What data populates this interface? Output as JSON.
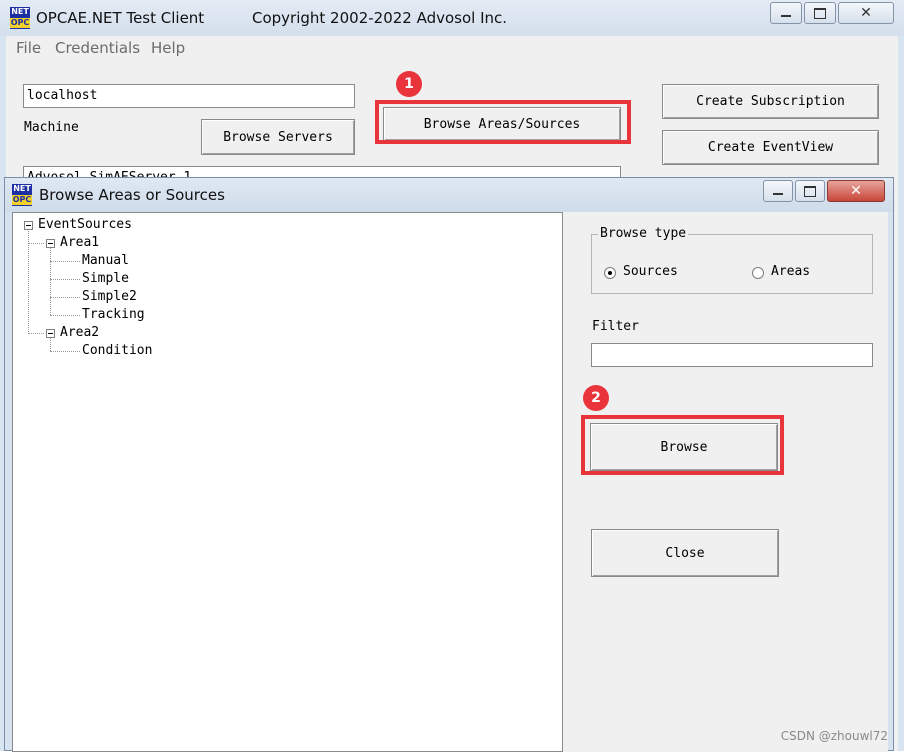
{
  "main_window": {
    "title": "OPCAE.NET Test Client",
    "copyright": "Copyright 2002-2022  Advosol Inc.",
    "icon_top": "NET",
    "icon_bottom": "OPC",
    "menu": [
      "File",
      "Credentials",
      "Help"
    ],
    "machine_value": "localhost",
    "machine_label": "Machine",
    "browse_servers_label": "Browse Servers",
    "browse_areas_label": "Browse Areas/Sources",
    "create_subscription_label": "Create Subscription",
    "create_eventview_label": "Create EventView",
    "server_value": "Advosol.SimAEServer.1"
  },
  "annotations": {
    "badge1": "1",
    "badge2": "2",
    "highlight_color": "#e8343a"
  },
  "dialog": {
    "title": "Browse Areas or Sources",
    "tree": {
      "root": "EventSources",
      "area1": "Area1",
      "area1_children": [
        "Manual",
        "Simple",
        "Simple2",
        "Tracking"
      ],
      "area2": "Area2",
      "area2_children": [
        "Condition"
      ]
    },
    "browse_type_label": "Browse type",
    "radio_sources": "Sources",
    "radio_areas": "Areas",
    "selected_browse_type": "Sources",
    "filter_label": "Filter",
    "filter_value": "",
    "browse_button": "Browse",
    "close_button": "Close"
  },
  "watermark": "CSDN @zhouwl72"
}
